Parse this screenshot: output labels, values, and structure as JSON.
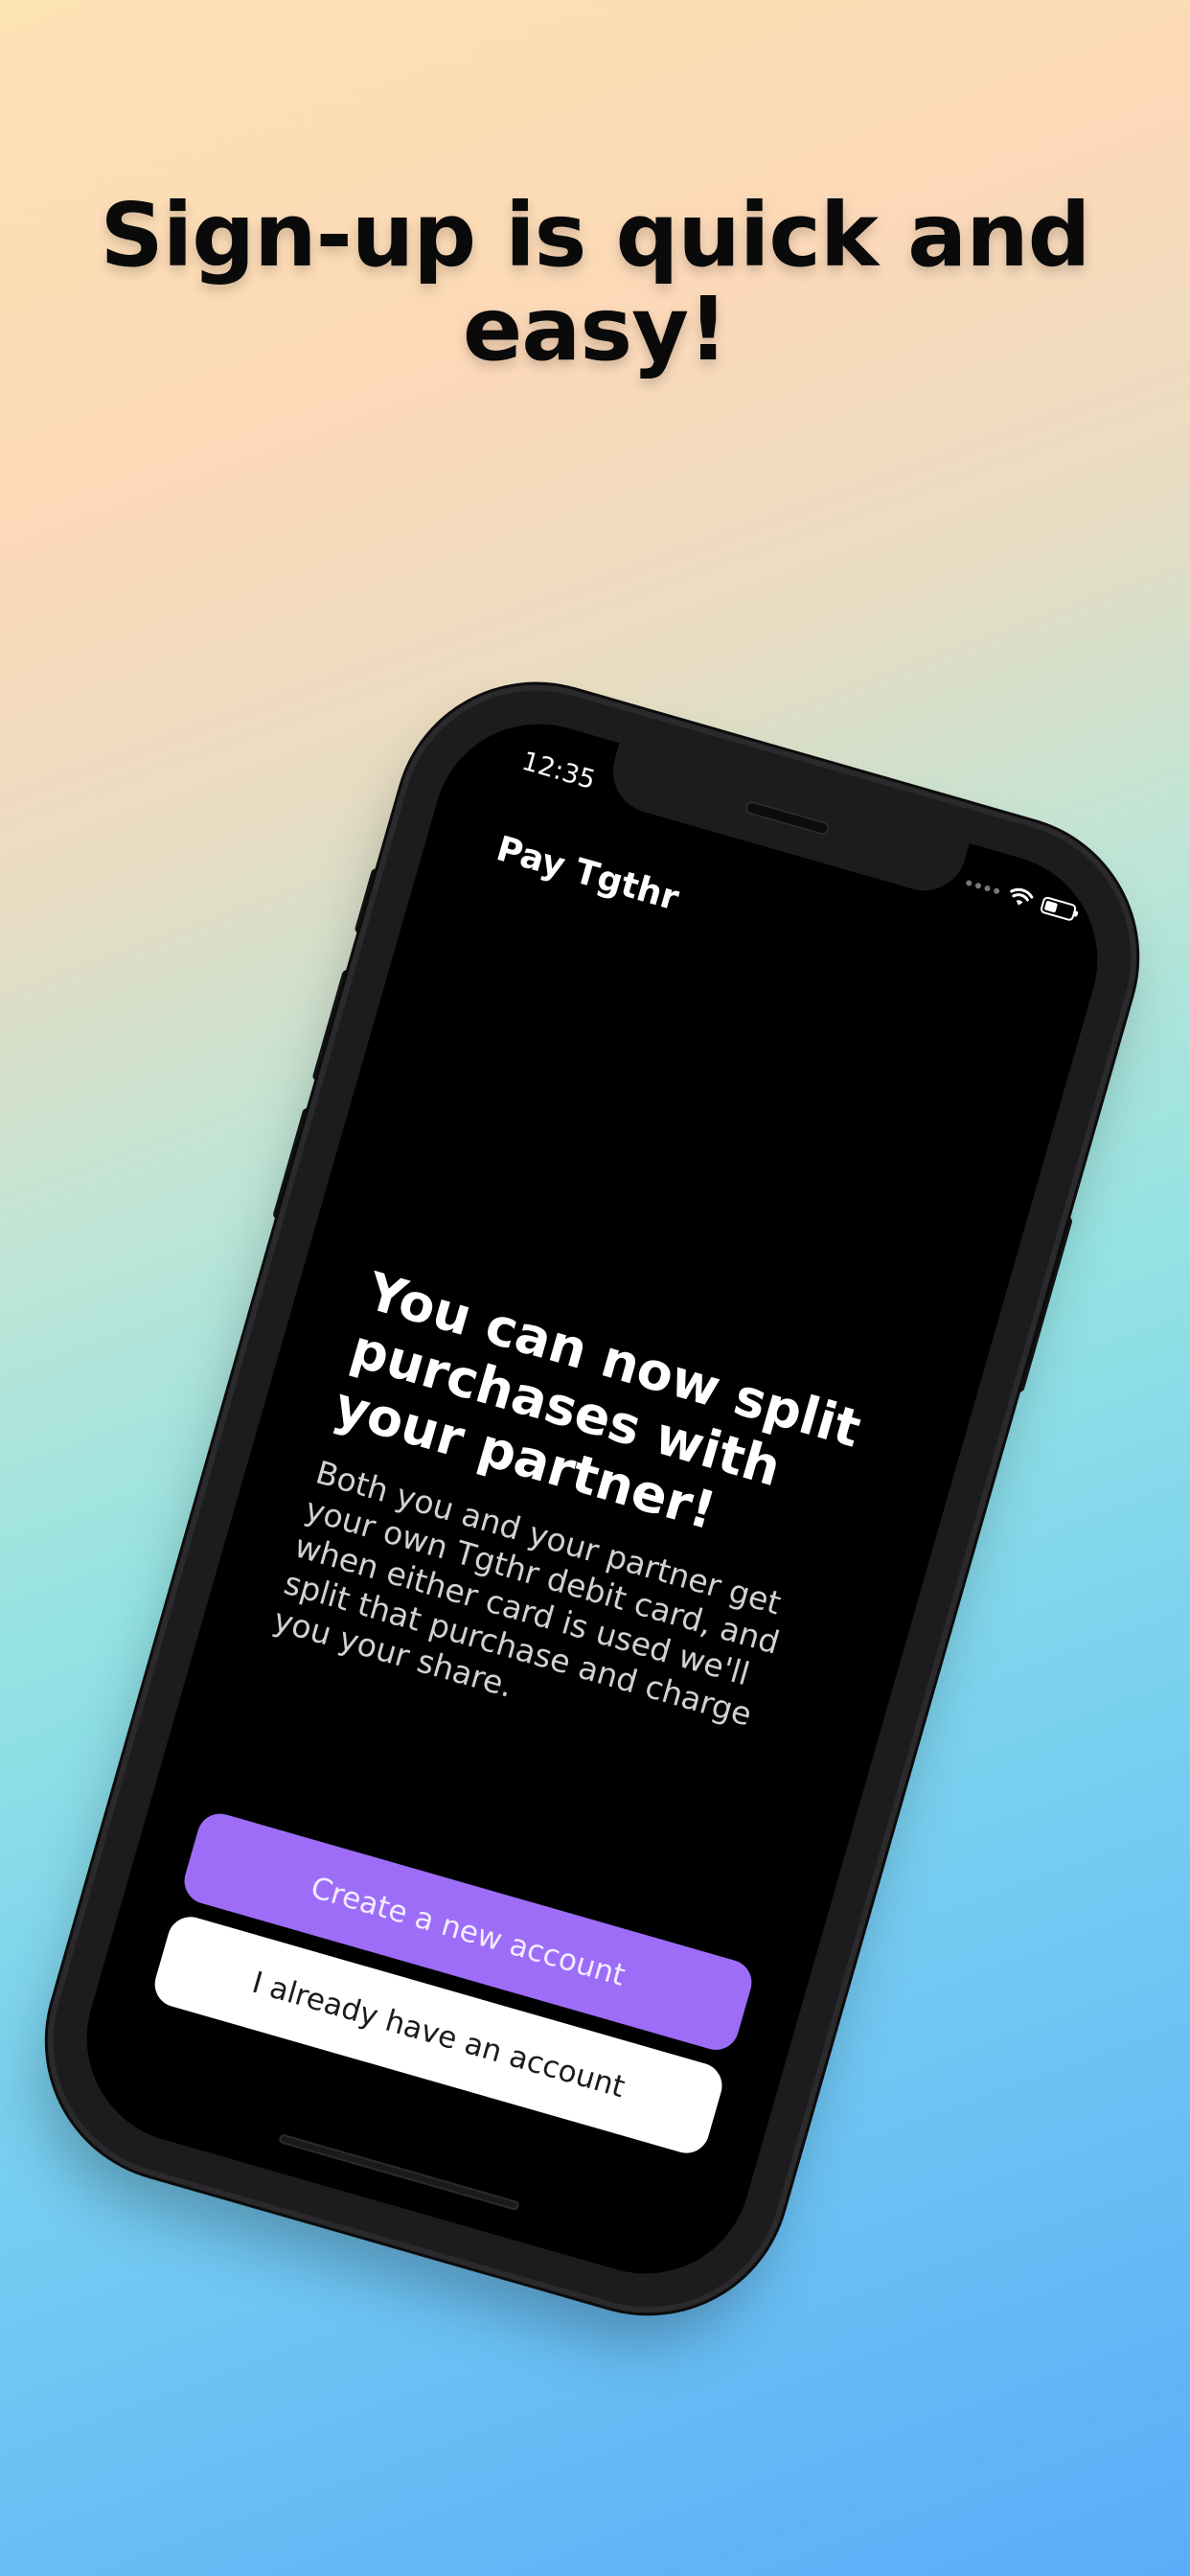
{
  "marketing": {
    "headline_line1": "Sign-up is quick and",
    "headline_line2": "easy!"
  },
  "status_bar": {
    "time": "12:35",
    "icons": [
      "signal-dots-icon",
      "wifi-icon",
      "battery-icon"
    ]
  },
  "app": {
    "brand": "Pay Tgthr",
    "title": "You can now split purchases with your partner!",
    "body": "Both you and your partner get your own Tgthr debit card, and when either card is used we'll split that purchase and charge you your share.",
    "primary_button": "Create a new account",
    "secondary_button": "I already have an account"
  },
  "colors": {
    "primary_accent": "#9d6df8",
    "screen_background": "#000000",
    "secondary_button": "#ffffff"
  }
}
